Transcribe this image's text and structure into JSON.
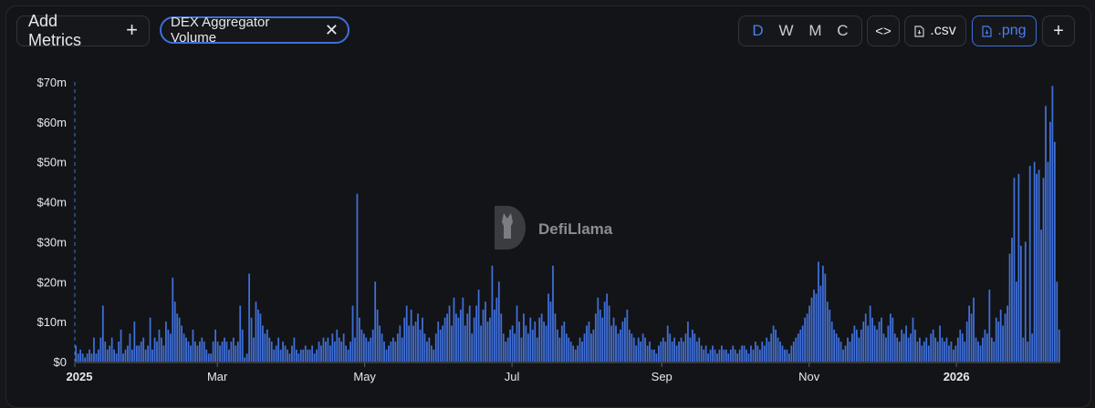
{
  "toolbar": {
    "add_metrics_label": "Add Metrics",
    "add_metrics_icon": "plus-icon",
    "metric_chip_label": "DEX Aggregator Volume",
    "metric_chip_icon": "close-icon",
    "intervals": [
      "D",
      "W",
      "M",
      "C"
    ],
    "active_interval": "D",
    "embed_label": "<>",
    "csv_label": ".csv",
    "png_label": ".png",
    "more_label": "+",
    "accent_color": "#3f6fd8"
  },
  "watermark": {
    "text": "DefiLlama",
    "icon": "llama-logo-icon"
  },
  "chart_data": {
    "type": "bar",
    "bar_color": "#3f6fd8",
    "y_ticks": [
      "$0",
      "$10m",
      "$20m",
      "$30m",
      "$40m",
      "$50m",
      "$60m",
      "$70m"
    ],
    "y_unit": "USD millions",
    "ylim": [
      0,
      70
    ],
    "x_tick_labels": [
      "2025",
      "Mar",
      "May",
      "Jul",
      "Sep",
      "Nov",
      "2026"
    ],
    "x_range": [
      "2025-01-01",
      "2026-02-13"
    ],
    "grid": false,
    "series": [
      {
        "values": [
          4,
          2,
          3,
          2,
          1,
          2,
          3,
          2,
          6,
          2,
          3,
          6,
          14,
          5,
          3,
          4,
          6,
          3,
          2,
          5,
          8,
          2,
          3,
          4,
          7,
          3,
          10,
          4,
          4,
          5,
          6,
          3,
          4,
          11,
          3,
          6,
          5,
          8,
          6,
          4,
          10,
          8,
          7,
          21,
          15,
          12,
          11,
          9,
          7,
          6,
          5,
          4,
          8,
          5,
          4,
          5,
          6,
          5,
          3,
          2,
          2,
          5,
          8,
          5,
          4,
          5,
          6,
          5,
          3,
          5,
          6,
          4,
          5,
          14,
          8,
          1,
          2,
          22,
          11,
          6,
          15,
          13,
          12,
          9,
          7,
          8,
          6,
          5,
          3,
          4,
          6,
          3,
          5,
          4,
          3,
          2,
          4,
          6,
          3,
          2,
          3,
          3,
          4,
          3,
          3,
          4,
          2,
          3,
          5,
          4,
          6,
          5,
          6,
          4,
          7,
          5,
          8,
          6,
          5,
          7,
          4,
          3,
          5,
          14,
          6,
          42,
          11,
          8,
          7,
          6,
          5,
          6,
          8,
          20,
          13,
          9,
          7,
          5,
          3,
          4,
          5,
          6,
          5,
          7,
          9,
          6,
          11,
          14,
          9,
          13,
          9,
          10,
          12,
          8,
          11,
          7,
          5,
          6,
          4,
          3,
          7,
          10,
          8,
          9,
          11,
          12,
          14,
          9,
          16,
          12,
          11,
          13,
          16,
          9,
          12,
          14,
          7,
          11,
          14,
          18,
          9,
          13,
          15,
          10,
          11,
          24,
          13,
          16,
          20,
          12,
          7,
          5,
          6,
          8,
          9,
          7,
          14,
          10,
          6,
          12,
          9,
          7,
          11,
          8,
          10,
          6,
          11,
          12,
          10,
          9,
          17,
          15,
          24,
          12,
          8,
          6,
          9,
          10,
          7,
          6,
          5,
          4,
          3,
          4,
          6,
          5,
          7,
          9,
          10,
          7,
          8,
          12,
          16,
          13,
          11,
          15,
          17,
          14,
          9,
          11,
          9,
          7,
          8,
          10,
          11,
          13,
          8,
          7,
          6,
          4,
          6,
          5,
          7,
          6,
          4,
          5,
          3,
          3,
          2,
          4,
          5,
          6,
          5,
          9,
          7,
          5,
          6,
          4,
          5,
          6,
          5,
          7,
          10,
          6,
          8,
          7,
          5,
          6,
          4,
          3,
          4,
          2,
          3,
          4,
          3,
          2,
          3,
          4,
          3,
          3,
          2,
          3,
          4,
          3,
          2,
          3,
          4,
          4,
          3,
          2,
          4,
          3,
          5,
          4,
          3,
          5,
          4,
          6,
          5,
          7,
          9,
          8,
          6,
          5,
          4,
          3,
          3,
          2,
          4,
          5,
          6,
          7,
          8,
          9,
          11,
          12,
          14,
          16,
          18,
          17,
          25,
          19,
          24,
          22,
          15,
          13,
          10,
          8,
          7,
          6,
          5,
          3,
          4,
          6,
          5,
          7,
          9,
          8,
          6,
          8,
          10,
          12,
          9,
          14,
          11,
          9,
          8,
          10,
          11,
          7,
          6,
          9,
          12,
          11,
          7,
          6,
          5,
          8,
          7,
          9,
          6,
          7,
          11,
          8,
          5,
          6,
          4,
          5,
          6,
          4,
          7,
          8,
          6,
          5,
          9,
          6,
          5,
          6,
          4,
          5,
          3,
          4,
          6,
          8,
          7,
          5,
          10,
          14,
          12,
          16,
          6,
          5,
          4,
          6,
          8,
          7,
          18,
          6,
          5,
          11,
          10,
          13,
          9,
          12,
          14,
          27,
          31,
          46,
          20,
          47,
          29,
          6,
          30,
          5,
          49,
          7,
          50,
          47,
          48,
          33,
          46,
          64,
          50,
          60,
          69,
          55,
          20,
          8
        ],
        "notes": "approximate daily volume in $m, read from bar heights"
      }
    ]
  }
}
